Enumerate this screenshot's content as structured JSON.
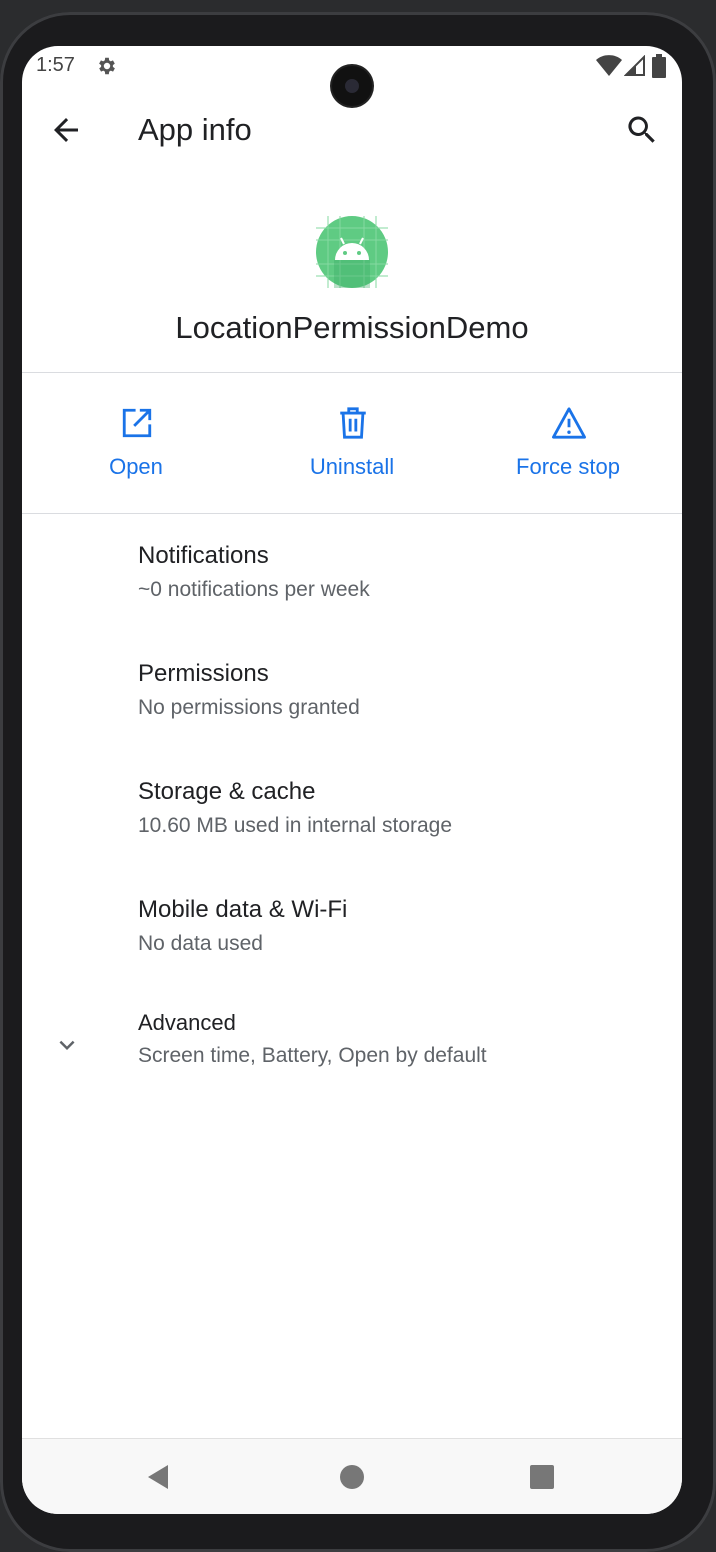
{
  "status_bar": {
    "time": "1:57",
    "icons": [
      "gear-icon",
      "wifi-icon",
      "signal-icon",
      "battery-icon"
    ]
  },
  "app_bar": {
    "title": "App info",
    "back_icon": "arrow-back-icon",
    "search_icon": "search-icon"
  },
  "app": {
    "name": "LocationPermissionDemo",
    "icon": "android-icon",
    "icon_color": "#5fcb83"
  },
  "actions": [
    {
      "label": "Open",
      "icon": "open-external-icon"
    },
    {
      "label": "Uninstall",
      "icon": "trash-icon"
    },
    {
      "label": "Force stop",
      "icon": "warning-icon"
    }
  ],
  "settings": [
    {
      "title": "Notifications",
      "summary": "~0 notifications per week"
    },
    {
      "title": "Permissions",
      "summary": "No permissions granted"
    },
    {
      "title": "Storage & cache",
      "summary": "10.60 MB used in internal storage"
    },
    {
      "title": "Mobile data & Wi-Fi",
      "summary": "No data used"
    },
    {
      "title": "Advanced",
      "summary": "Screen time, Battery, Open by default",
      "icon": "chevron-down-icon"
    }
  ],
  "nav": {
    "icons": [
      "back-triangle-icon",
      "home-circle-icon",
      "recents-square-icon"
    ]
  },
  "colors": {
    "accent": "#1a73e8",
    "text_primary": "#202124",
    "text_secondary": "#5f6368",
    "divider": "#dadce0"
  }
}
